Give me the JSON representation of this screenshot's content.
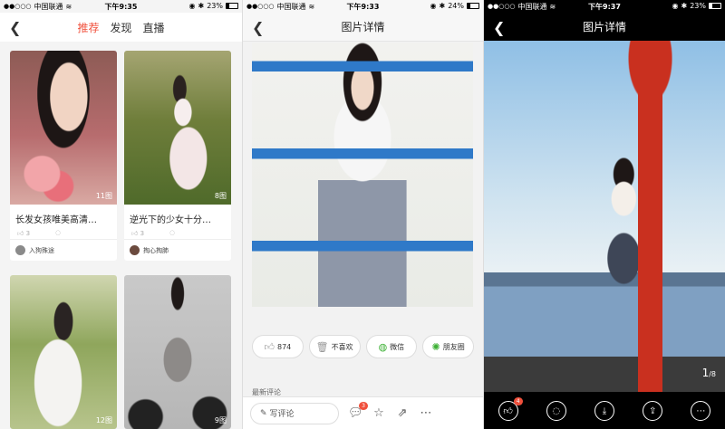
{
  "status": {
    "carrier": "中国联通",
    "p1": {
      "time": "下午9:35",
      "battery": "23%"
    },
    "p2": {
      "time": "下午9:33",
      "battery": "24%"
    },
    "p3": {
      "time": "下午9:37",
      "battery": "23%"
    }
  },
  "feed": {
    "tabs": [
      "推荐",
      "发现",
      "直播"
    ],
    "active_tab": "推荐",
    "cards": [
      {
        "count": "11图",
        "title": "长发女孩唯美高清…",
        "likes": "3",
        "author": "入狗殊途"
      },
      {
        "count": "8图",
        "title": "逆光下的少女十分…",
        "likes": "3",
        "author": "掏心掏肺"
      },
      {
        "count": "12图",
        "title": "",
        "likes": "",
        "author": ""
      },
      {
        "count": "9图",
        "title": "",
        "likes": "",
        "author": ""
      }
    ]
  },
  "detail": {
    "title": "图片详情",
    "actions": {
      "like": "874",
      "dislike": "不喜欢",
      "wechat": "微信",
      "moments": "朋友圈"
    },
    "comments_header": "最新评论",
    "write_placeholder": "写评论",
    "comment_badge": "3"
  },
  "viewer": {
    "title": "图片详情",
    "pager_current": "1",
    "pager_total": "8",
    "like_badge": "4"
  }
}
